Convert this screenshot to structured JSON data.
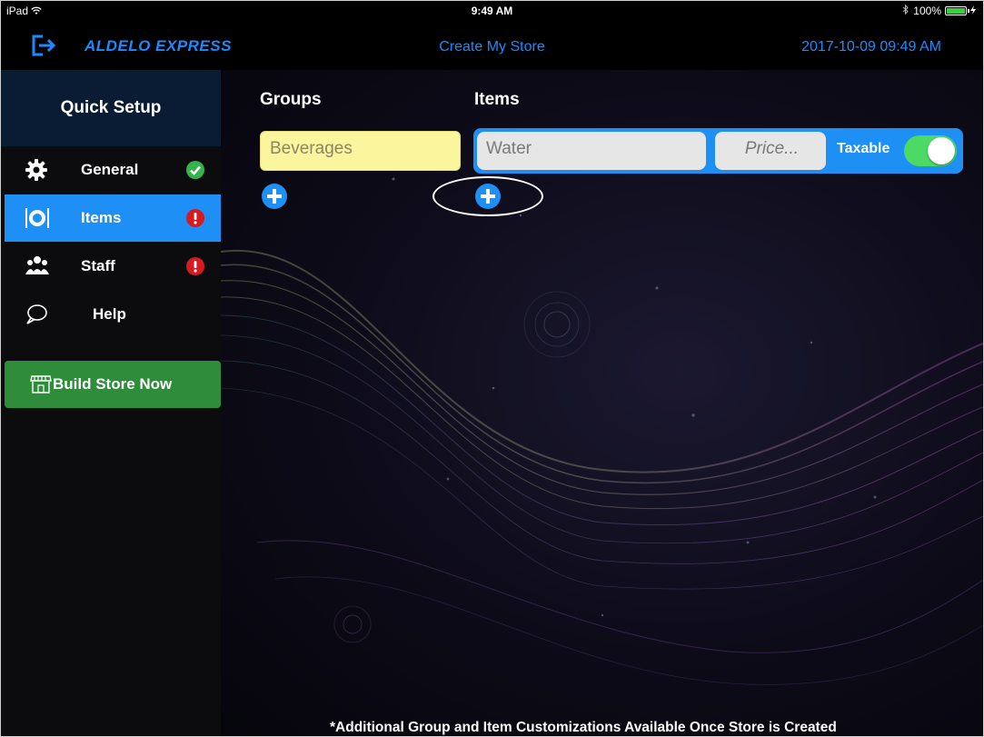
{
  "status_bar": {
    "device": "iPad",
    "time": "9:49 AM",
    "battery": "100%"
  },
  "header": {
    "logo": "ALDELO EXPRESS",
    "title": "Create My Store",
    "datetime": "2017-10-09 09:49 AM"
  },
  "sidebar": {
    "title": "Quick Setup",
    "items": [
      {
        "label": "General",
        "status": "complete"
      },
      {
        "label": "Items",
        "status": "incomplete"
      },
      {
        "label": "Staff",
        "status": "incomplete"
      },
      {
        "label": "Help",
        "status": ""
      }
    ],
    "build_button": "Build Store Now"
  },
  "main": {
    "groups_heading": "Groups",
    "items_heading": "Items",
    "group_value": "Beverages",
    "item_name_value": "Water",
    "item_price_placeholder": "Price...",
    "taxable_label": "Taxable",
    "taxable_on": true,
    "footer_note": "*Additional Group and Item Customizations Available Once Store is Created"
  },
  "colors": {
    "accent": "#1e8ff5",
    "header_text": "#1a8bff",
    "sidebar_header": "#0a1c33",
    "build_button": "#2f8c3a",
    "group_input": "#fbf59e",
    "complete": "#35b34a",
    "incomplete": "#d71920",
    "toggle_on": "#4cd964"
  }
}
